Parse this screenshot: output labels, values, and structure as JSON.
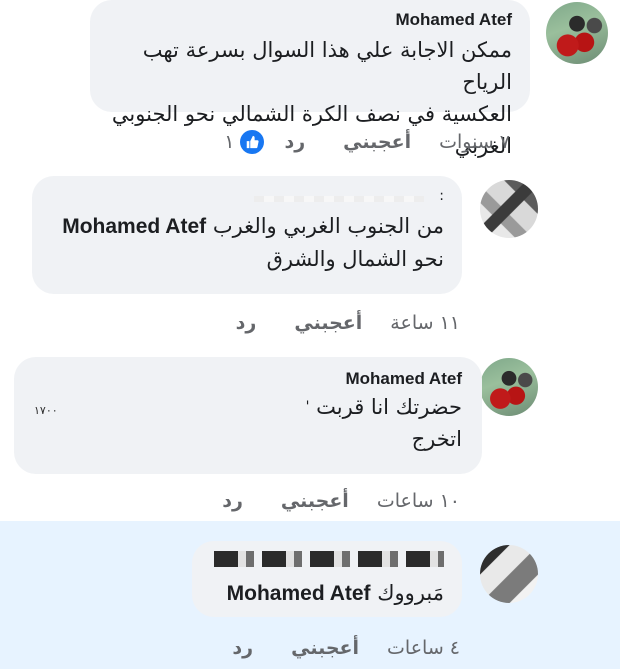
{
  "comments": [
    {
      "author": "Mohamed Atef",
      "line1": "ممكن الاجابة علي هذا السوال بسرعة تهب الرياح",
      "line2": "العكسية في نصف الكرة الشمالي نحو الجنوبي الغربي",
      "time": "٧ سنوات",
      "like_label": "أعجبني",
      "reply_label": "رد",
      "reaction_count": "١"
    },
    {
      "author_hidden_mark": ":",
      "mention": "Mohamed Atef",
      "line1_rest": "من الجنوب الغربي والغرب",
      "line2": "نحو الشمال والشرق",
      "time": "١١ ساعة",
      "like_label": "أعجبني",
      "reply_label": "رد"
    },
    {
      "author": "Mohamed Atef",
      "line1": "حضرتك انا قربت",
      "line1_tail": "'",
      "redacted_snippet": "١٧٠٠",
      "line2": "اتخرج",
      "time": "١٠ ساعات",
      "like_label": "أعجبني",
      "reply_label": "رد"
    },
    {
      "mention": "Mohamed Atef",
      "line1_rest": "مَبرووك",
      "time": "٤ ساعات",
      "like_label": "أعجبني",
      "reply_label": "رد"
    }
  ],
  "colors": {
    "bubble": "#f0f2f5",
    "highlight": "#e7f3ff",
    "like_blue": "#1877f2",
    "meta_text": "#65676b"
  },
  "icons": {
    "reaction": "thumbs-up-icon"
  }
}
